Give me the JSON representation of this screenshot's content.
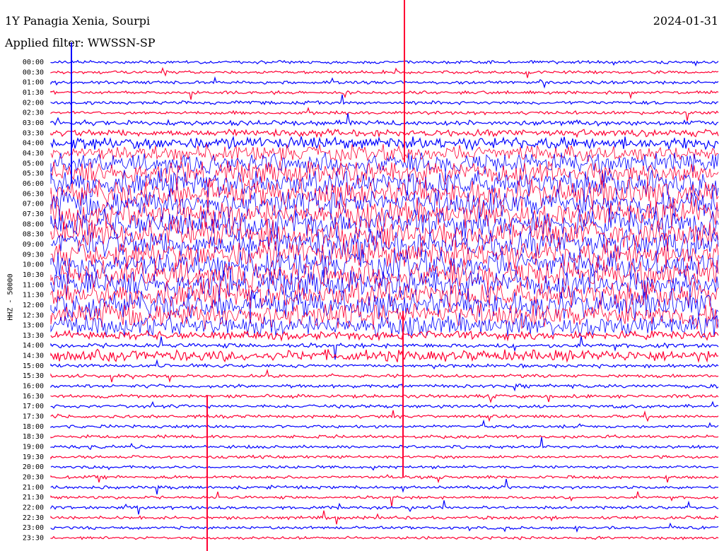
{
  "header": {
    "station": "1Y Panagia Xenia, Sourpi",
    "date": "2024-01-31",
    "filter": "Applied filter: WWSSN-SP"
  },
  "axis": {
    "ylabel": "HHZ - 50000"
  },
  "colors": {
    "even_rows": "#0000ff",
    "odd_rows": "#ff0033"
  },
  "chart_data": {
    "type": "line",
    "title": "1Y Panagia Xenia, Sourpi",
    "subtitle": "Applied filter: WWSSN-SP",
    "ylabel": "HHZ - 50000",
    "xlabel": "",
    "date": "2024-01-31",
    "row_labels": [
      "00:00",
      "00:30",
      "01:00",
      "01:30",
      "02:00",
      "02:30",
      "03:00",
      "03:30",
      "04:00",
      "04:30",
      "05:00",
      "05:30",
      "06:00",
      "06:30",
      "07:00",
      "07:30",
      "08:00",
      "08:30",
      "09:00",
      "09:30",
      "10:00",
      "10:30",
      "11:00",
      "11:30",
      "12:00",
      "12:30",
      "13:00",
      "13:30",
      "14:00",
      "14:30",
      "15:00",
      "15:30",
      "16:00",
      "16:30",
      "17:00",
      "17:30",
      "18:00",
      "18:30",
      "19:00",
      "19:30",
      "20:00",
      "20:30",
      "21:00",
      "21:30",
      "22:00",
      "22:30",
      "23:00",
      "23:30"
    ],
    "series_colors": [
      "#0000ff",
      "#ff0033"
    ],
    "row_activity": [
      0.05,
      0.04,
      0.05,
      0.05,
      0.06,
      0.06,
      0.12,
      0.2,
      0.4,
      0.55,
      0.7,
      0.85,
      1.0,
      1.0,
      1.0,
      1.0,
      1.0,
      1.0,
      1.0,
      1.0,
      1.0,
      1.0,
      1.0,
      1.0,
      1.0,
      0.9,
      0.75,
      0.25,
      0.1,
      0.35,
      0.06,
      0.05,
      0.07,
      0.06,
      0.06,
      0.05,
      0.05,
      0.05,
      0.05,
      0.04,
      0.04,
      0.05,
      0.05,
      0.04,
      0.05,
      0.05,
      0.04,
      0.04
    ],
    "grid": false
  }
}
